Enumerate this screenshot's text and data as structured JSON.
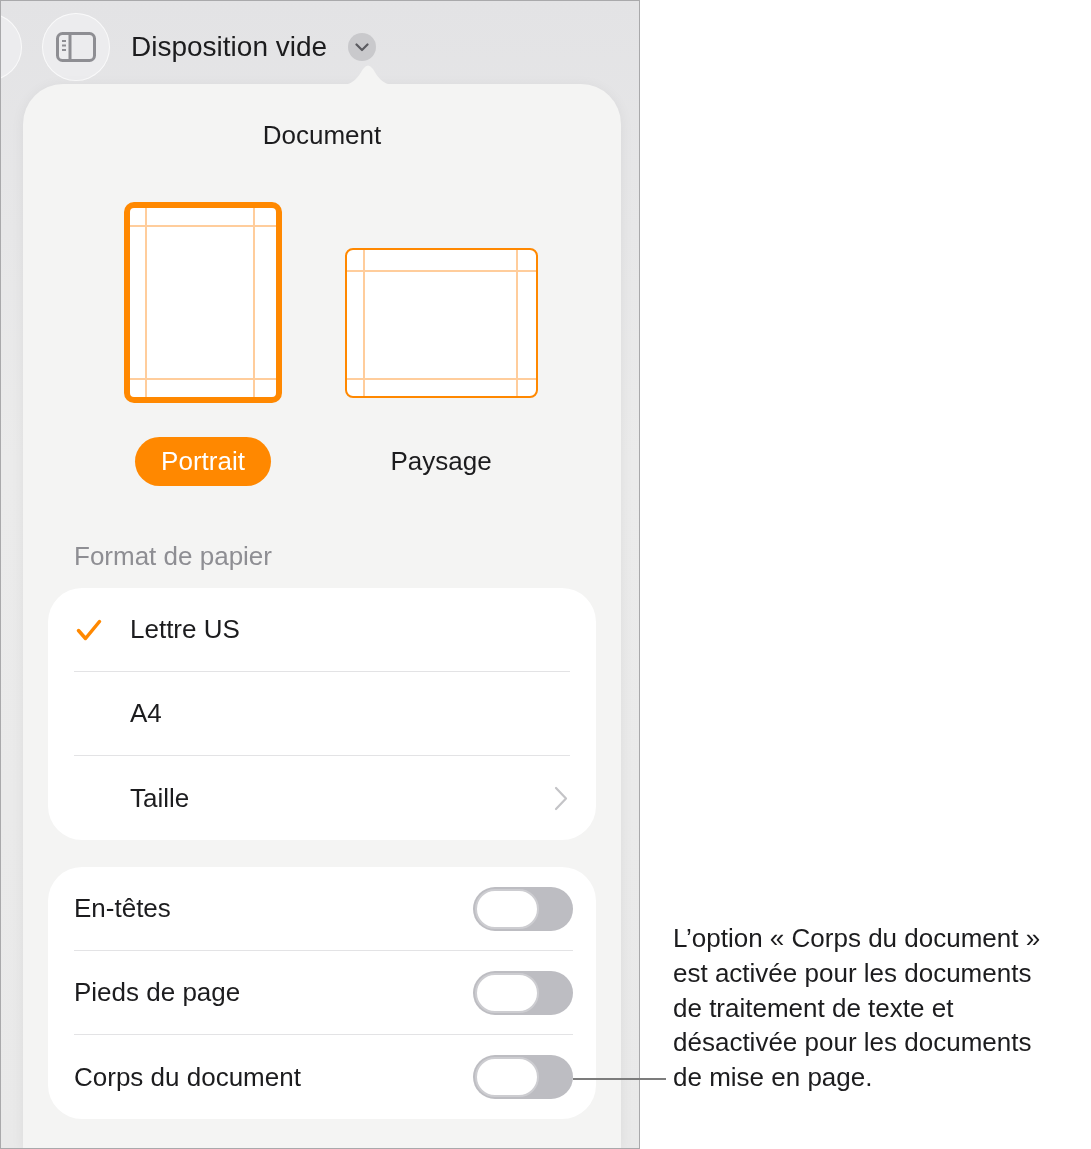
{
  "toolbar": {
    "title": "Disposition vide"
  },
  "popover": {
    "title": "Document",
    "orientations": [
      {
        "kind": "portrait",
        "label": "Portrait",
        "selected": true
      },
      {
        "kind": "landscape",
        "label": "Paysage",
        "selected": false
      }
    ],
    "paper_format": {
      "heading": "Format de papier",
      "items": [
        {
          "kind": "choice",
          "label": "Lettre US",
          "selected": true
        },
        {
          "kind": "choice",
          "label": "A4",
          "selected": false
        },
        {
          "kind": "submenu",
          "label": "Taille",
          "selected": false
        }
      ]
    },
    "toggles": [
      {
        "label": "En-têtes",
        "on": false
      },
      {
        "label": "Pieds de page",
        "on": false
      },
      {
        "label": "Corps du document",
        "on": false
      }
    ]
  },
  "callout": {
    "text": "L’option « Corps du document » est activée pour les documents de traitement de texte et désactivée pour les documents de mise en page."
  }
}
